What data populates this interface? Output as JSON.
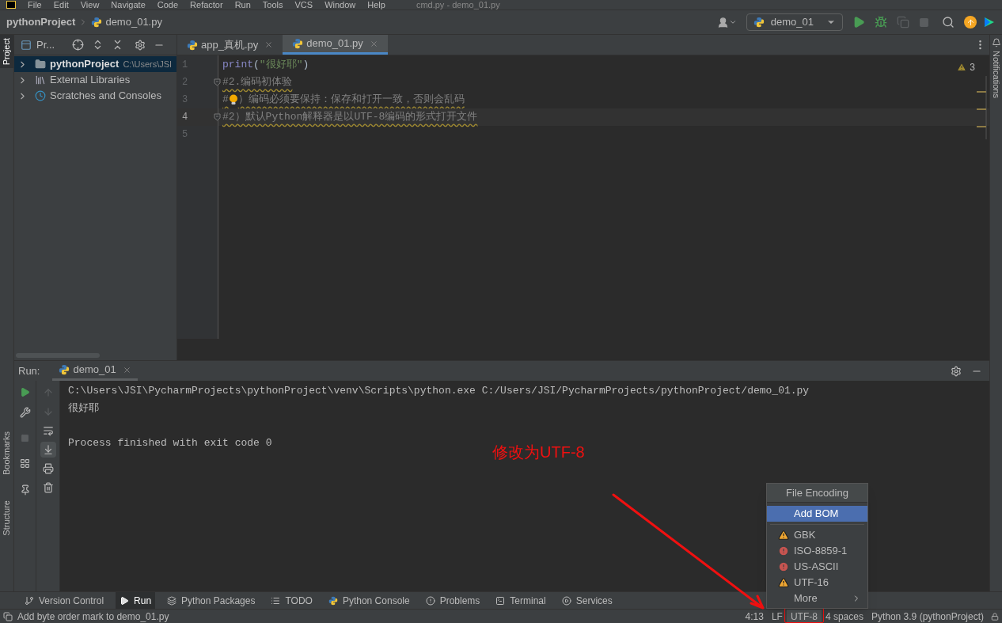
{
  "menu_bar": {
    "items": [
      "File",
      "Edit",
      "View",
      "Navigate",
      "Code",
      "Refactor",
      "Run",
      "Tools",
      "VCS",
      "Window",
      "Help"
    ],
    "title": "cmd.py - demo_01.py"
  },
  "nav_bar": {
    "breadcrumbs": [
      "pythonProject",
      "demo_01.py"
    ],
    "run_config": "demo_01"
  },
  "left_stripe": [
    {
      "label": "Project",
      "selected": true
    },
    {
      "label": "Bookmarks",
      "selected": false
    },
    {
      "label": "Structure",
      "selected": false
    }
  ],
  "right_stripe": {
    "label": "Notifications"
  },
  "project_panel": {
    "title": "Pr...",
    "tree": [
      {
        "kind": "folder",
        "label": "pythonProject",
        "path": "C:\\Users\\JSI",
        "expanded": false,
        "selected": true
      },
      {
        "kind": "library",
        "label": "External Libraries",
        "expanded": false,
        "selected": false
      },
      {
        "kind": "scratches",
        "label": "Scratches and Consoles",
        "expanded": false,
        "selected": false
      }
    ]
  },
  "editor": {
    "tabs": [
      {
        "label": "app_真机.py",
        "selected": false
      },
      {
        "label": "demo_01.py",
        "selected": true
      }
    ],
    "problems": "3",
    "lines": [
      {
        "number": "1",
        "current": false,
        "fold": false,
        "tokens": [
          {
            "kind": "function",
            "text": "print"
          },
          {
            "kind": "plain",
            "text": "("
          },
          {
            "kind": "string",
            "text": "\"很好耶\""
          },
          {
            "kind": "plain",
            "text": ")"
          }
        ]
      },
      {
        "number": "2",
        "current": false,
        "fold": true,
        "tokens": [
          {
            "kind": "comment",
            "text": "#2.编码初体验"
          }
        ]
      },
      {
        "number": "3",
        "current": false,
        "fold": false,
        "tokens": [
          {
            "kind": "comment",
            "text": "#"
          },
          {
            "kind": "bulb"
          },
          {
            "kind": "comment",
            "text": "）编码必须要保持：保存和打开一致，否则会乱码"
          }
        ]
      },
      {
        "number": "4",
        "current": true,
        "fold": true,
        "tokens": [
          {
            "kind": "comment",
            "text": "#2）默认Python解释器是以UTF-8编码的形式打开文件"
          }
        ]
      },
      {
        "number": "5",
        "current": false,
        "fold": false
      }
    ]
  },
  "run_panel": {
    "label": "Run:",
    "tabs": [
      {
        "label": "demo_01",
        "selected": true
      }
    ],
    "output": [
      {
        "kind": "command",
        "text": "C:\\Users\\JSI\\PycharmProjects\\pythonProject\\venv\\Scripts\\python.exe C:/Users/JSI/PycharmProjects/pythonProject/demo_01.py"
      },
      {
        "kind": "output",
        "text": "很好耶"
      },
      {
        "kind": "exit",
        "text": "Process finished with exit code 0"
      }
    ]
  },
  "annotation": {
    "text": "修改为UTF-8"
  },
  "encoding_popup": {
    "title": "File Encoding",
    "items": [
      {
        "kind": "action",
        "label": "Add BOM",
        "selected": true
      },
      {
        "kind": "warning",
        "label": "GBK",
        "selected": false
      },
      {
        "kind": "error",
        "label": "ISO-8859-1",
        "selected": false
      },
      {
        "kind": "error",
        "label": "US-ASCII",
        "selected": false
      },
      {
        "kind": "warning",
        "label": "UTF-16",
        "selected": false
      },
      {
        "kind": "submenu",
        "label": "More",
        "selected": false
      }
    ]
  },
  "tool_windows": [
    {
      "label": "Version Control",
      "selected": false
    },
    {
      "label": "Run",
      "selected": true
    },
    {
      "label": "Python Packages",
      "selected": false
    },
    {
      "label": "TODO",
      "selected": false
    },
    {
      "label": "Python Console",
      "selected": false
    },
    {
      "label": "Problems",
      "selected": false
    },
    {
      "label": "Terminal",
      "selected": false
    },
    {
      "label": "Services",
      "selected": false
    }
  ],
  "status_bar": {
    "message": "Add byte order mark to demo_01.py",
    "items": [
      {
        "text": "4:13",
        "selected": false
      },
      {
        "text": "LF",
        "selected": false
      },
      {
        "text": "UTF-8",
        "selected": true
      },
      {
        "text": "4 spaces",
        "selected": false
      },
      {
        "text": "Python 3.9 (pythonProject)",
        "selected": false
      }
    ]
  }
}
